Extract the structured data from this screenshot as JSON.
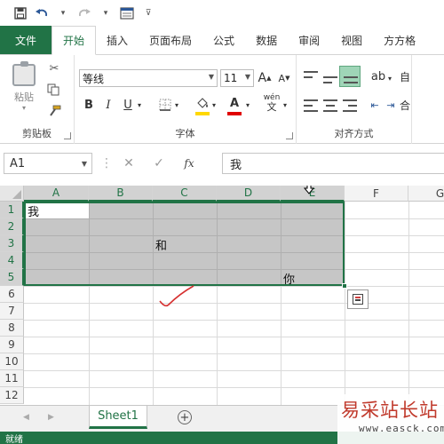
{
  "quick_access": {
    "icons": [
      "save-icon",
      "undo-icon",
      "redo-icon",
      "form-icon",
      "customize-icon"
    ]
  },
  "ribbon_tabs": [
    {
      "label": "文件",
      "active": false
    },
    {
      "label": "开始",
      "active": true
    },
    {
      "label": "插入",
      "active": false
    },
    {
      "label": "页面布局",
      "active": false
    },
    {
      "label": "公式",
      "active": false
    },
    {
      "label": "数据",
      "active": false
    },
    {
      "label": "审阅",
      "active": false
    },
    {
      "label": "视图",
      "active": false
    },
    {
      "label": "方方格",
      "active": false
    }
  ],
  "ribbon": {
    "clipboard": {
      "paste_label": "粘贴",
      "group_label": "剪贴板"
    },
    "font": {
      "font_name": "等线",
      "font_size": "11",
      "grow_label": "A",
      "shrink_label": "A",
      "bold_label": "B",
      "italic_label": "I",
      "underline_label": "U",
      "phonetic_label": "wén",
      "group_label": "字体",
      "fill_color": "#ffd800",
      "font_color": "#e00000"
    },
    "alignment": {
      "group_label": "对齐方式",
      "wrap_label": "自",
      "merge_label": "合"
    }
  },
  "formula_bar": {
    "name_box": "A1",
    "formula": "我"
  },
  "grid": {
    "columns": [
      "A",
      "B",
      "C",
      "D",
      "E",
      "F",
      "G"
    ],
    "rows": [
      "1",
      "2",
      "3",
      "4",
      "5",
      "6",
      "7",
      "8",
      "9",
      "10",
      "11",
      "12"
    ],
    "selected_range": "A1:E5",
    "accent": "#217346",
    "cells": [
      {
        "ref": "A1",
        "value": "我"
      },
      {
        "ref": "C3",
        "value": "和"
      },
      {
        "ref": "E5",
        "value": "你"
      }
    ]
  },
  "sheets": {
    "tabs": [
      "Sheet1"
    ],
    "active": "Sheet1"
  },
  "status": {
    "text": "就绪"
  },
  "watermark": {
    "title": "易采站长站",
    "url": "www.easck.com"
  }
}
